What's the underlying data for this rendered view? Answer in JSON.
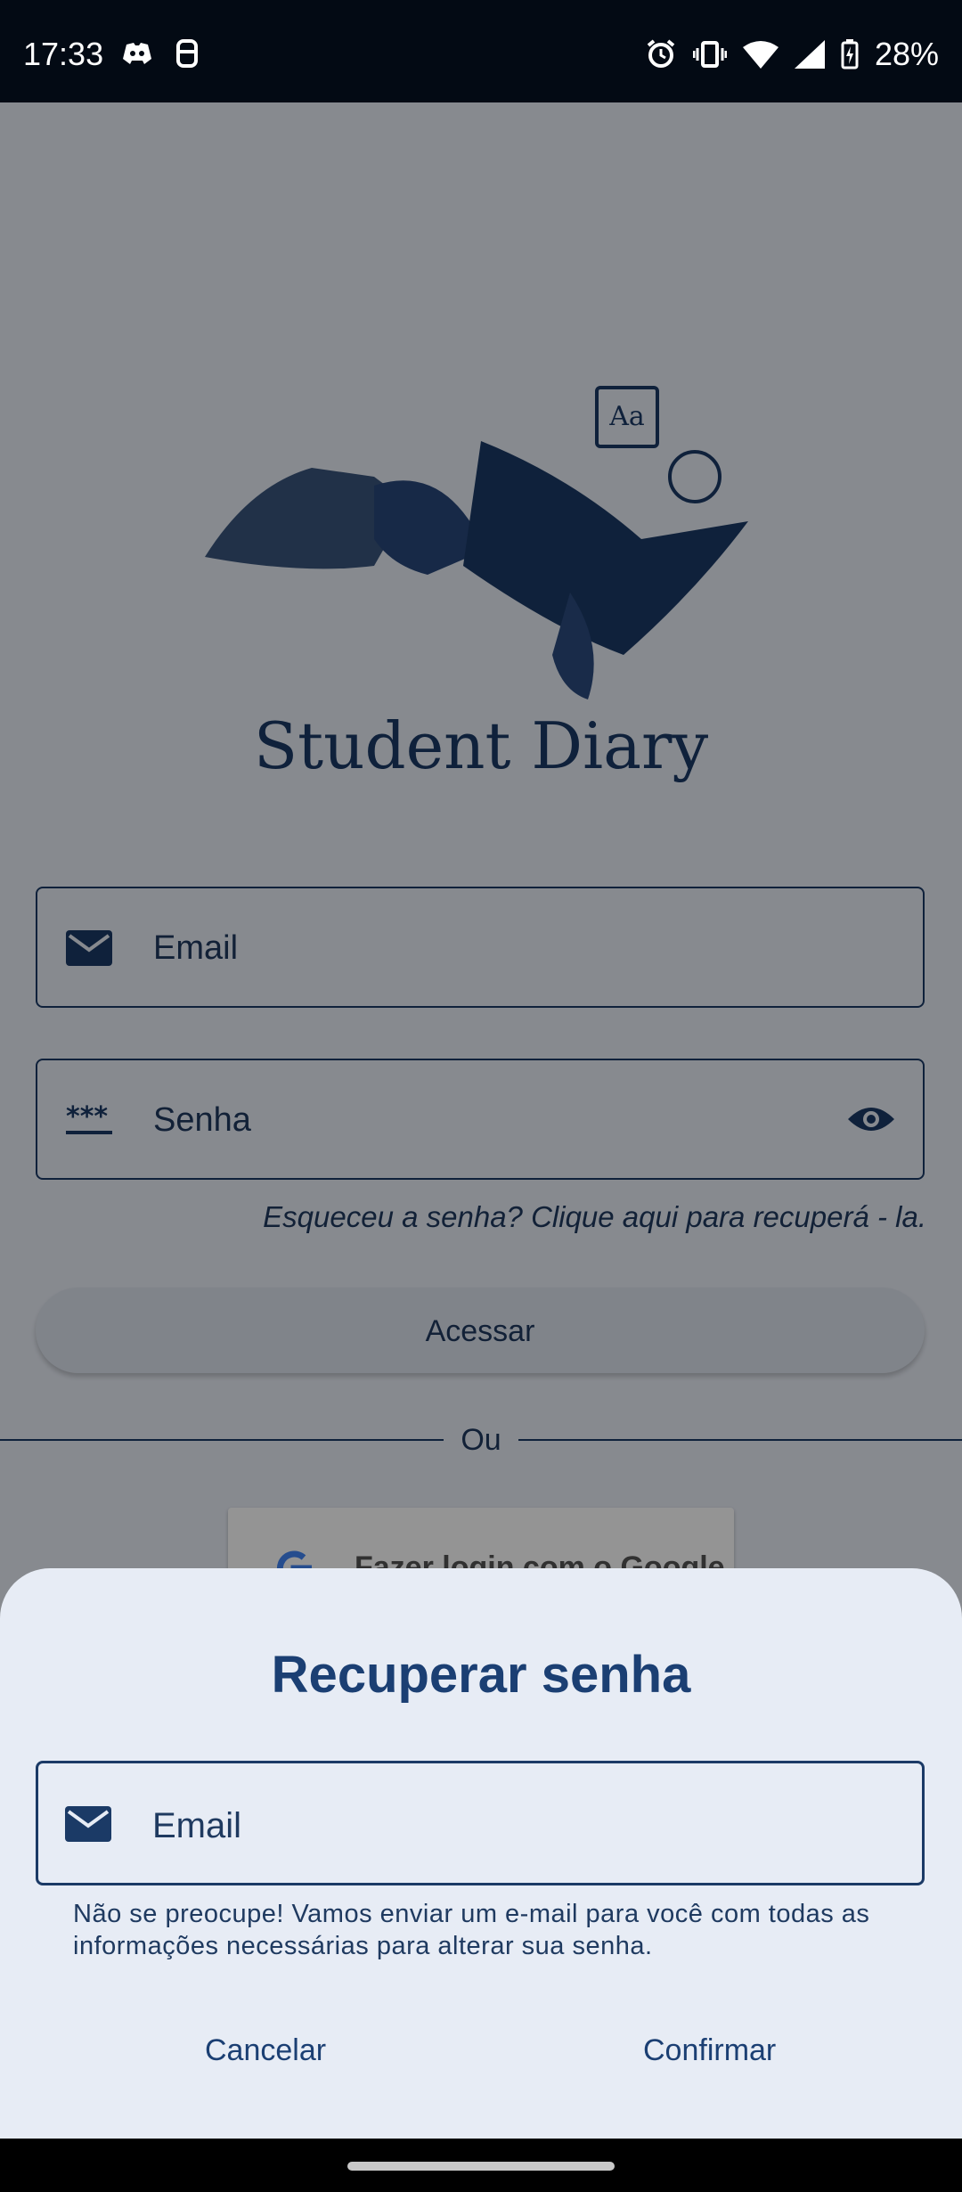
{
  "status_bar": {
    "time": "17:33",
    "battery": "28%",
    "left_icons": [
      "discord-icon",
      "lifebuoy-icon"
    ],
    "right_icons": [
      "alarm-icon",
      "vibrate-icon",
      "wifi-icon",
      "signal-icon",
      "battery-charging-icon"
    ]
  },
  "app": {
    "title": "Student Diary"
  },
  "login_form": {
    "email_label": "Email",
    "password_label": "Senha",
    "forgot_password": "Esqueceu a senha? Clique aqui para recuperá - la.",
    "access_button": "Acessar",
    "divider_text": "Ou",
    "google_button": "Fazer login com o Google"
  },
  "recover_dialog": {
    "title": "Recuperar senha",
    "email_label": "Email",
    "helper_text": "Não se preocupe! Vamos enviar um e-mail para você com todas as informações necessárias para alterar sua senha.",
    "cancel_button": "Cancelar",
    "confirm_button": "Confirmar"
  },
  "colors": {
    "primary": "#1b3a66",
    "sheet_background": "#e7ecf5",
    "scrim": "rgba(0,0,0,0.42)"
  }
}
